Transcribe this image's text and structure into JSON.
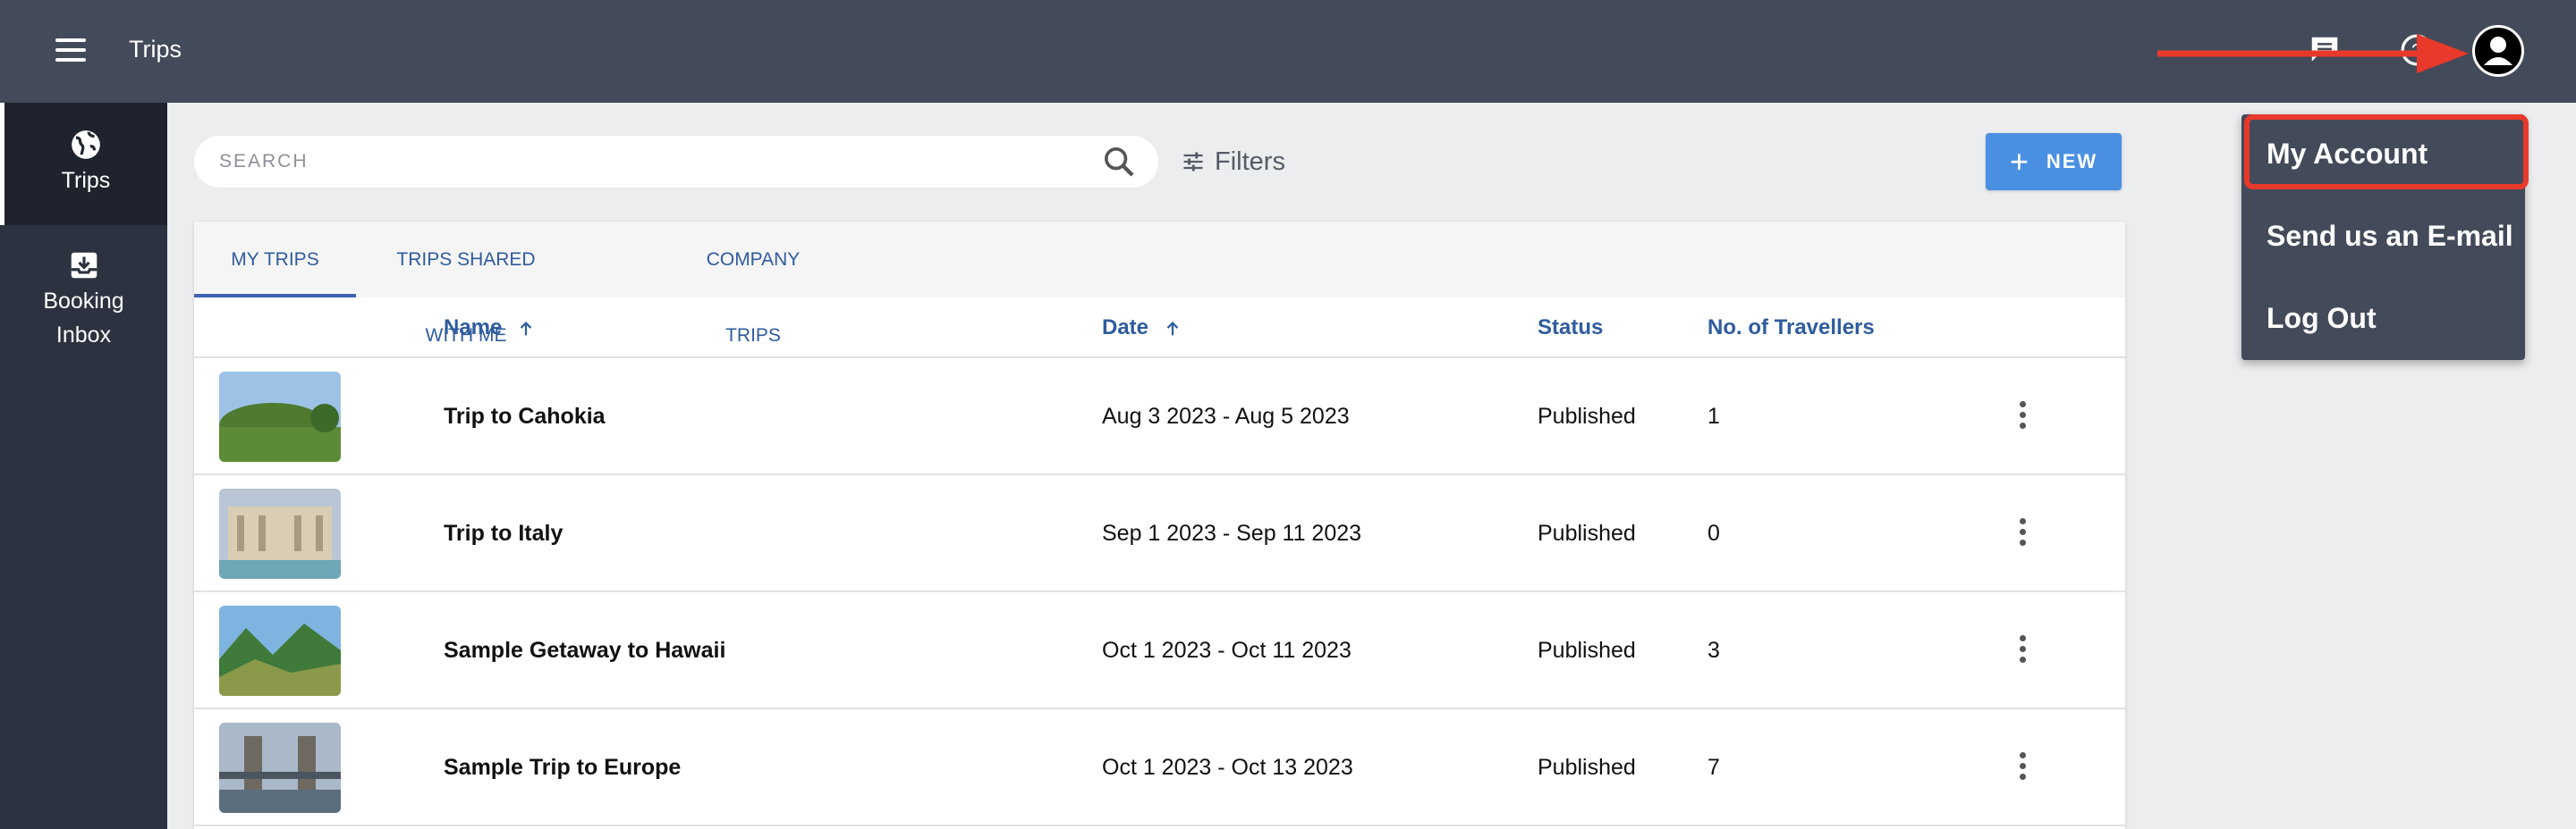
{
  "header": {
    "title": "Trips"
  },
  "sidebar": {
    "items": [
      {
        "label": "Trips",
        "icon": "globe-icon"
      },
      {
        "label": "Booking Inbox",
        "line1": "Booking",
        "line2": "Inbox",
        "icon": "inbox-icon"
      }
    ]
  },
  "toolbar": {
    "search_placeholder": "SEARCH",
    "filters_label": "Filters",
    "new_label": "NEW"
  },
  "tabs": [
    {
      "label": "MY TRIPS",
      "active": true
    },
    {
      "label": "TRIPS SHARED WITH ME",
      "active": false
    },
    {
      "label": "COMPANY TRIPS",
      "active": false
    }
  ],
  "table": {
    "columns": {
      "name": "Name",
      "date": "Date",
      "status": "Status",
      "travellers": "No. of Travellers"
    },
    "rows": [
      {
        "name": "Trip to Cahokia",
        "date": "Aug 3 2023 - Aug 5 2023",
        "status": "Published",
        "travellers": "1"
      },
      {
        "name": "Trip to Italy",
        "date": "Sep 1 2023 - Sep 11 2023",
        "status": "Published",
        "travellers": "0"
      },
      {
        "name": "Sample Getaway to Hawaii",
        "date": "Oct 1 2023 - Oct 11 2023",
        "status": "Published",
        "travellers": "3"
      },
      {
        "name": "Sample Trip to Europe",
        "date": "Oct 1 2023 - Oct 13 2023",
        "status": "Published",
        "travellers": "7"
      }
    ]
  },
  "account_menu": {
    "items": [
      {
        "label": "My Account"
      },
      {
        "label": "Send us an E-mail"
      },
      {
        "label": "Log Out"
      }
    ]
  },
  "colors": {
    "topbar": "#434a59",
    "sidebar": "#2d3240",
    "accent": "#4a90e2",
    "link": "#2f5c9e",
    "annotation": "#e8392a"
  }
}
